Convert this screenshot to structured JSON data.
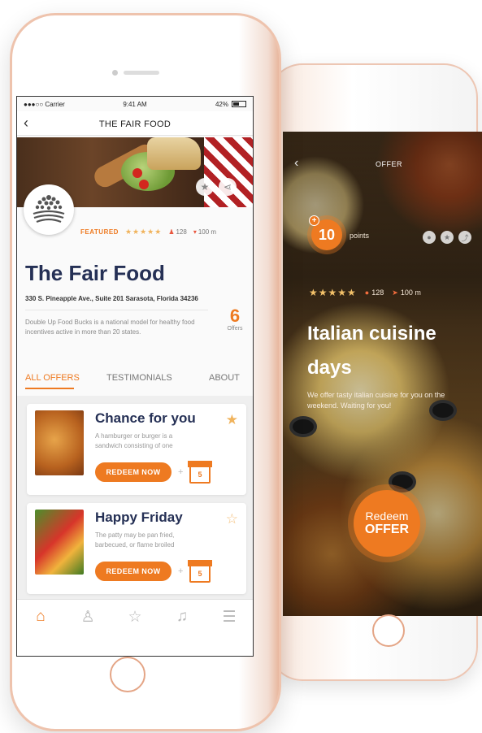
{
  "front": {
    "status": {
      "carrier": "●●●○○ Carrier",
      "time": "9:41 AM",
      "battery": "42%"
    },
    "nav": {
      "back_icon": "chevron-left-icon",
      "title": "THE FAIR FOOD"
    },
    "hero": {
      "favorite_icon": "star-icon",
      "share_icon": "share-icon"
    },
    "meta": {
      "featured": "FEATURED",
      "stars": "★★★★★",
      "likes": "128",
      "distance": "100 m"
    },
    "restaurant": {
      "name": "The Fair Food",
      "address": "330 S. Pineapple Ave., Suite 201 Sarasota, Florida 34236",
      "description": "Double Up Food Bucks is a national model for healthy food incentives active in more than 20 states.",
      "offers_count": "6",
      "offers_label": "Offers"
    },
    "tabs": [
      "ALL OFFERS",
      "TESTIMONIALS",
      "ABOUT"
    ],
    "offers": [
      {
        "title": "Chance for you",
        "desc": "A hamburger or burger is a sandwich consisting of one",
        "button": "REDEEM NOW",
        "gift_value": "5",
        "starred": true
      },
      {
        "title": "Happy Friday",
        "desc": "The patty may be pan fried, barbecued, or flame broiled",
        "button": "REDEEM NOW",
        "gift_value": "5",
        "starred": false
      }
    ],
    "tabbar": [
      "home-icon",
      "user-icon",
      "star-icon",
      "bell-icon",
      "menu-icon"
    ],
    "accent": "#ee7a21"
  },
  "back": {
    "nav": {
      "back_icon": "chevron-left-icon",
      "title": "OFFER"
    },
    "points": {
      "value": "10",
      "label": "points",
      "plus": "+"
    },
    "meta": {
      "stars": "★★★★★",
      "likes": "128",
      "distance": "100 m"
    },
    "title": "Italian cuisine days",
    "description": "We offer tasty italian cuisine for you on the weekend. Waiting for you!",
    "redeem": {
      "line1": "Redeem",
      "line2": "OFFER"
    }
  }
}
